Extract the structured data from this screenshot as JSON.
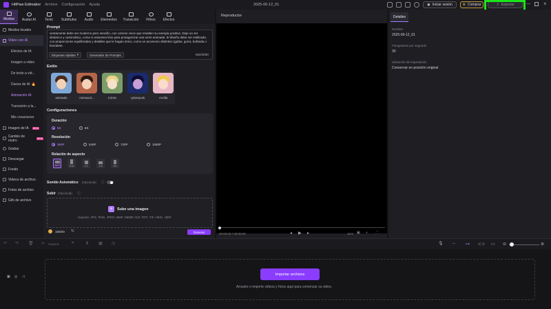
{
  "app": {
    "name": "HitPaw Edimakor",
    "menus": [
      "Archivo",
      "Configuración",
      "Ayuda"
    ],
    "project_title": "2025-06-12_01"
  },
  "titlebar": {
    "login": "Iniciar sesión",
    "buy": "Comprar",
    "export": "Exportar"
  },
  "toolbar": {
    "tabs": [
      "Medios",
      "Avatar AI",
      "Texto",
      "Subtítulos",
      "Audio",
      "Elementos",
      "Transición",
      "Filtros",
      "Efectos"
    ]
  },
  "sidebar": {
    "local_media": "Medios locales",
    "ai_video": "Video con IA",
    "sub_items": [
      "Efectos de IA",
      "Imagen a video",
      "De texto a vid...",
      "Danza de IA",
      "Animación IA",
      "Transición a la...",
      "Mis creaciones"
    ],
    "items": [
      "Imagen de IA",
      "Cambio de rostro",
      "Grabar",
      "Descargar",
      "Fondo",
      "Videos de archivo",
      "Fotos de archivo",
      "Gifs de archivo"
    ],
    "new_badge": "NEW",
    "fire_emoji": "🔥"
  },
  "panel": {
    "prompt_label": "Prompt",
    "prompt_text": "ventamente debe ser moderno pero sencillo, con colores vivos que resalten su energía positiva. Deje un ser dinámico y carismático, como si estuviera listo para protagonizar una serie animada. El diseño debe ser estilizado, con proporciones equilibradas y detalles que le hagan único, como un accesorio distintivo (gafas, gorra, bufanda o brazalete.",
    "quick_tags": "Etiquetas rápidas",
    "prompt_generator": "Generador de Prompts",
    "char_count": "552/2000",
    "style_label": "Estilo",
    "styles": [
      "animado",
      "Animació...",
      "Cómic",
      "cyberpunk",
      "Arcilla"
    ],
    "config_label": "Configuraciones",
    "duration_label": "Duración",
    "durations": [
      "5S",
      "8S"
    ],
    "resolution_label": "Resolución",
    "resolutions": [
      "360P",
      "540P",
      "720P",
      "1080P"
    ],
    "aspect_label": "Relación de aspecto",
    "aspects": [
      "16:9",
      "9:16",
      "1:1",
      "4:3",
      "3:4"
    ],
    "auto_sound": "Sonido Automático",
    "optional": "(Opcional)",
    "upload_label": "Subir",
    "upload_optional": "(Opcional)",
    "upload_btn": "Sube una imagen",
    "upload_formats": "Soporta: JPG, PNG, JPEG, BMP, WEBP, GIF, TIFF, TIF, HEIC, HEIF",
    "credits": "100/20",
    "generate": "Generar"
  },
  "player": {
    "title": "Reproductor",
    "time": "00:00:00 / 00:00:00",
    "ratio": "16:9"
  },
  "details": {
    "tab": "Detalles",
    "name_label": "Nombre",
    "name_value": "2025-06-12_01",
    "fps_label": "Fotogramas por segundo",
    "fps_value": "30",
    "import_label": "Ubicación de importación",
    "import_value": "Conservar en posición original"
  },
  "timeline": {
    "separate": "Separar",
    "import_btn": "Importar archivos",
    "hint": "Arrastre o importe videos y fotos aquí para comenzar su video."
  },
  "colors": {
    "accent": "#8a3cff",
    "highlight": "#19e619"
  }
}
